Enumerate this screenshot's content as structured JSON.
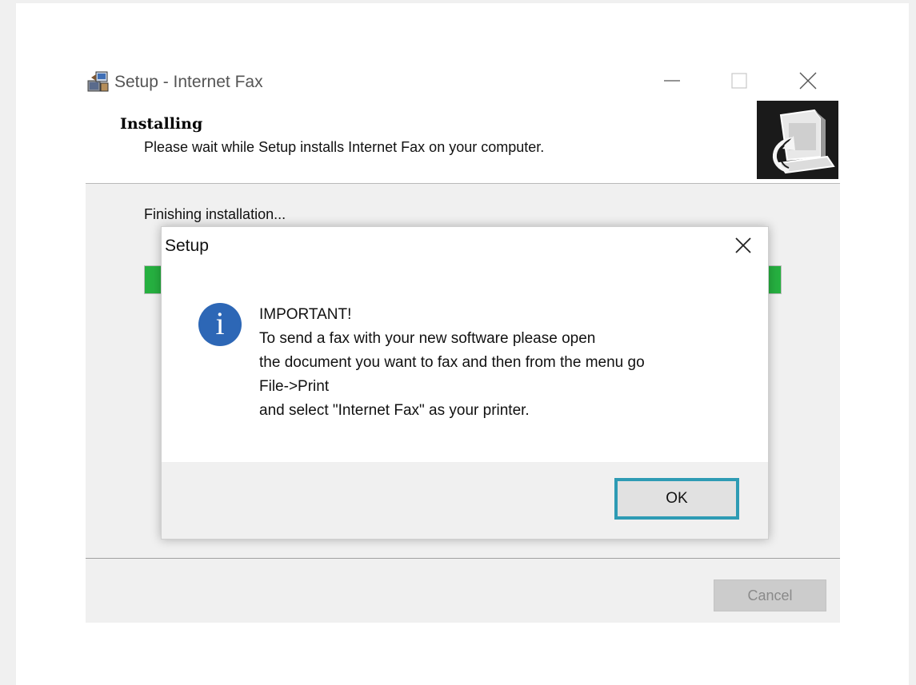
{
  "installer": {
    "title": "Setup - Internet Fax",
    "header_title": "Installing",
    "header_subtitle": "Please wait while Setup installs Internet Fax on your computer.",
    "status": "Finishing installation...",
    "progress": 1.0,
    "cancel_label": "Cancel",
    "controls": [
      "minimize-icon",
      "maximize-icon",
      "close-icon"
    ]
  },
  "dialog": {
    "title": "Setup",
    "icon": "info-icon",
    "icon_glyph": "i",
    "message_lines": [
      "IMPORTANT!",
      "To send a fax with your new software please open",
      "the document you want to fax and then from the menu go",
      "File->Print",
      "and select \"Internet Fax\" as your printer."
    ],
    "ok_label": "OK"
  },
  "colors": {
    "progress_fill": "#26b040",
    "ok_focus_border": "#2e9bb4",
    "info_icon": "#2d67b6"
  }
}
